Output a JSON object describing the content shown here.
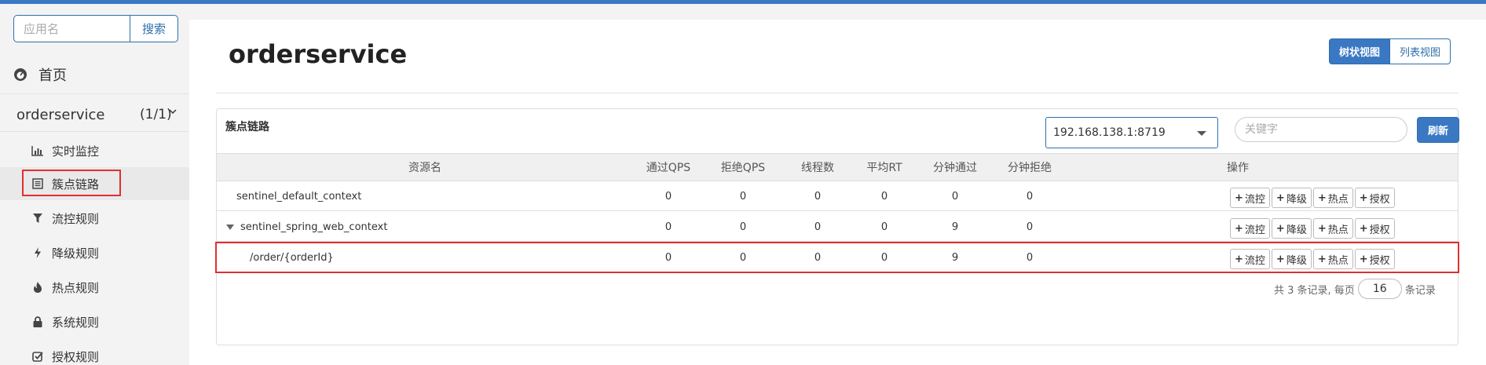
{
  "colors": {
    "accent": "#3a78c3",
    "highlight": "#e03030"
  },
  "search": {
    "placeholder": "应用名",
    "button": "搜索"
  },
  "nav": {
    "home": "首页",
    "app": {
      "name": "orderservice",
      "count": "(1/1)"
    },
    "items": [
      {
        "label": "实时监控",
        "icon": "bar-chart-icon"
      },
      {
        "label": "簇点链路",
        "icon": "list-icon",
        "active": true
      },
      {
        "label": "流控规则",
        "icon": "filter-icon"
      },
      {
        "label": "降级规则",
        "icon": "bolt-icon"
      },
      {
        "label": "热点规则",
        "icon": "fire-icon"
      },
      {
        "label": "系统规则",
        "icon": "lock-icon"
      },
      {
        "label": "授权规则",
        "icon": "check-icon"
      }
    ]
  },
  "page": {
    "title": "orderservice",
    "view_tree": "树状视图",
    "view_list": "列表视图"
  },
  "card": {
    "title": "簇点链路",
    "machine": "192.168.138.1:8719",
    "keyword_placeholder": "关键字",
    "refresh": "刷新"
  },
  "table": {
    "headers": [
      "资源名",
      "通过QPS",
      "拒绝QPS",
      "线程数",
      "平均RT",
      "分钟通过",
      "分钟拒绝",
      "操作"
    ],
    "rows": [
      {
        "name": "sentinel_default_context",
        "pass_qps": "0",
        "block_qps": "0",
        "threads": "0",
        "avg_rt": "0",
        "min_pass": "0",
        "min_block": "0"
      },
      {
        "name": "sentinel_spring_web_context",
        "pass_qps": "0",
        "block_qps": "0",
        "threads": "0",
        "avg_rt": "0",
        "min_pass": "9",
        "min_block": "0"
      },
      {
        "name": "/order/{orderId}",
        "pass_qps": "0",
        "block_qps": "0",
        "threads": "0",
        "avg_rt": "0",
        "min_pass": "9",
        "min_block": "0"
      }
    ],
    "ops": {
      "flow": "流控",
      "degrade": "降级",
      "hotspot": "热点",
      "auth": "授权"
    },
    "op_symbol": "+"
  },
  "pager": {
    "prefix": "共 3 条记录, 每页",
    "size": "16",
    "suffix": "条记录"
  }
}
